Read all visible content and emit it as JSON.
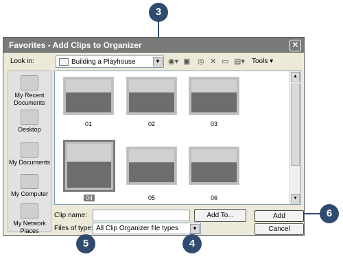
{
  "window": {
    "title": "Favorites - Add Clips to Organizer",
    "close_glyph": "✕"
  },
  "toolbar": {
    "lookin_label": "Look in:",
    "lookin_value": "Building a Playhouse",
    "tools_label": "Tools ▾",
    "icons": [
      "back-icon",
      "up-folder-icon",
      "search-web-icon",
      "delete-icon",
      "new-folder-icon",
      "views-icon"
    ]
  },
  "places": [
    {
      "label": "My Recent Documents",
      "icon": "recent-documents-icon"
    },
    {
      "label": "Desktop",
      "icon": "desktop-icon"
    },
    {
      "label": "My Documents",
      "icon": "my-documents-icon"
    },
    {
      "label": "My Computer",
      "icon": "my-computer-icon"
    },
    {
      "label": "My Network Places",
      "icon": "network-places-icon"
    }
  ],
  "clips": [
    {
      "label": "01"
    },
    {
      "label": "02"
    },
    {
      "label": "03"
    },
    {
      "label": "04",
      "selected": true
    },
    {
      "label": "05"
    },
    {
      "label": "06"
    }
  ],
  "form": {
    "clip_name_label": "Clip name:",
    "clip_name_value": "",
    "add_to_label": "Add To...",
    "files_of_type_label": "Files of type:",
    "files_of_type_value": "All Clip Organizer file types",
    "add_label": "Add",
    "cancel_label": "Cancel"
  },
  "callouts": [
    "3",
    "4",
    "5",
    "6"
  ]
}
